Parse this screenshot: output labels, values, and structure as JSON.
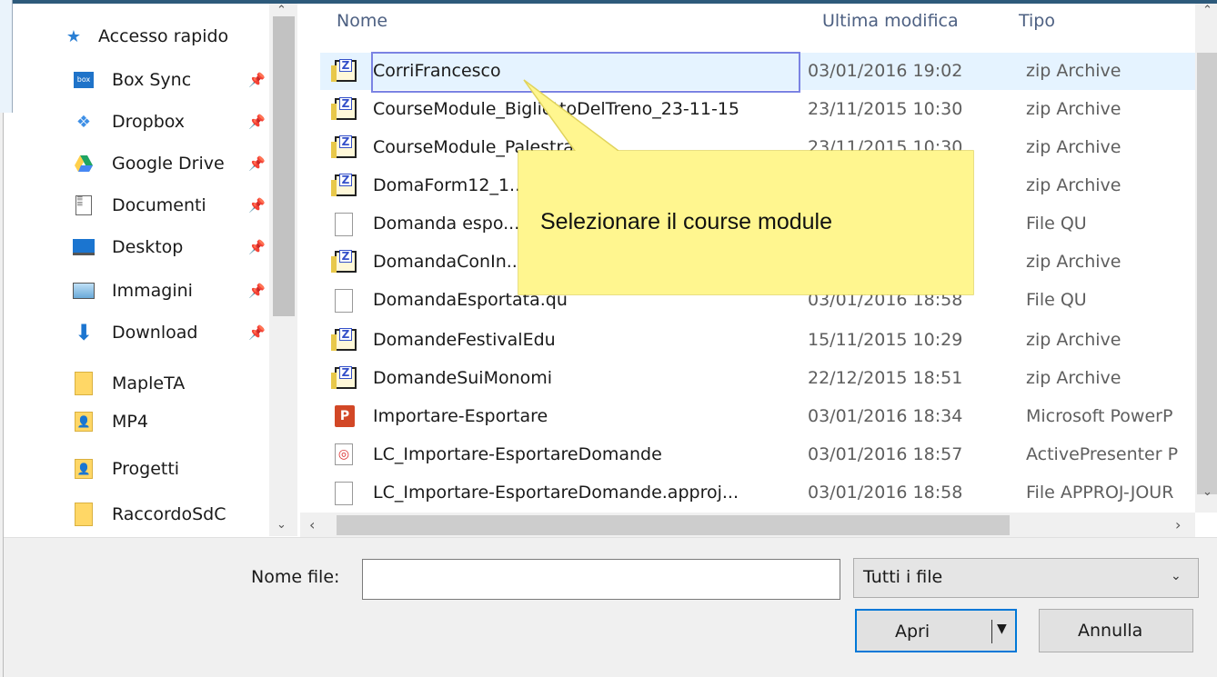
{
  "sidebar": {
    "quick_access": "Accesso rapido",
    "items": [
      {
        "label": "Box Sync",
        "icon": "box-icon",
        "pinned": true
      },
      {
        "label": "Dropbox",
        "icon": "dropbox-icon",
        "pinned": true
      },
      {
        "label": "Google Drive",
        "icon": "google-drive-icon",
        "pinned": true
      },
      {
        "label": "Documenti",
        "icon": "documents-icon",
        "pinned": true
      },
      {
        "label": "Desktop",
        "icon": "desktop-icon",
        "pinned": true
      },
      {
        "label": "Immagini",
        "icon": "pictures-icon",
        "pinned": true
      },
      {
        "label": "Download",
        "icon": "download-icon",
        "pinned": true
      },
      {
        "label": "MapleTA",
        "icon": "folder-icon",
        "pinned": false
      },
      {
        "label": "MP4",
        "icon": "folder-user-icon",
        "pinned": false
      },
      {
        "label": "Progetti",
        "icon": "folder-user-icon",
        "pinned": false
      },
      {
        "label": "RaccordoSdC",
        "icon": "folder-icon",
        "pinned": false
      }
    ]
  },
  "columns": {
    "name": "Nome",
    "modified": "Ultima modifica",
    "type": "Tipo"
  },
  "files": [
    {
      "name": "CorriFrancesco",
      "date": "03/01/2016 19:02",
      "type": "zip Archive",
      "icon": "zip"
    },
    {
      "name": "CourseModule_BigliettoDelTreno_23-11-15",
      "date": "23/11/2015 10:30",
      "type": "zip Archive",
      "icon": "zip"
    },
    {
      "name": "CourseModule_Palestra...",
      "date": "23/11/2015 10:30",
      "type": "zip Archive",
      "icon": "zip"
    },
    {
      "name": "DomaForm12_1...",
      "date": "",
      "type": "zip Archive",
      "icon": "zip"
    },
    {
      "name": "Domanda espo...",
      "date": "",
      "type": "File QU",
      "icon": "doc"
    },
    {
      "name": "DomandaConIn...",
      "date": "",
      "type": "zip Archive",
      "icon": "zip"
    },
    {
      "name": "DomandaEsportata.qu",
      "date": "03/01/2016 18:58",
      "type": "File QU",
      "icon": "doc"
    },
    {
      "name": "DomandeFestivalEdu",
      "date": "15/11/2015 10:29",
      "type": "zip Archive",
      "icon": "zip"
    },
    {
      "name": "DomandeSuiMonomi",
      "date": "22/12/2015 18:51",
      "type": "zip Archive",
      "icon": "zip"
    },
    {
      "name": "Importare-Esportare",
      "date": "03/01/2016 18:34",
      "type": "Microsoft PowerP",
      "icon": "ppt"
    },
    {
      "name": "LC_Importare-EsportareDomande",
      "date": "03/01/2016 18:57",
      "type": "ActivePresenter P",
      "icon": "ap"
    },
    {
      "name": "LC_Importare-EsportareDomande.approj...",
      "date": "03/01/2016 18:58",
      "type": "File APPROJ-JOUR",
      "icon": "doc"
    }
  ],
  "footer": {
    "filename_label": "Nome file:",
    "filename_value": "",
    "filter_value": "Tutti i file",
    "open_label": "Apri",
    "cancel_label": "Annulla"
  },
  "callout": {
    "text": "Selezionare il course module"
  },
  "colors": {
    "accent": "#0078d7",
    "selection": "#e5f3ff",
    "callout": "#fff68f"
  }
}
